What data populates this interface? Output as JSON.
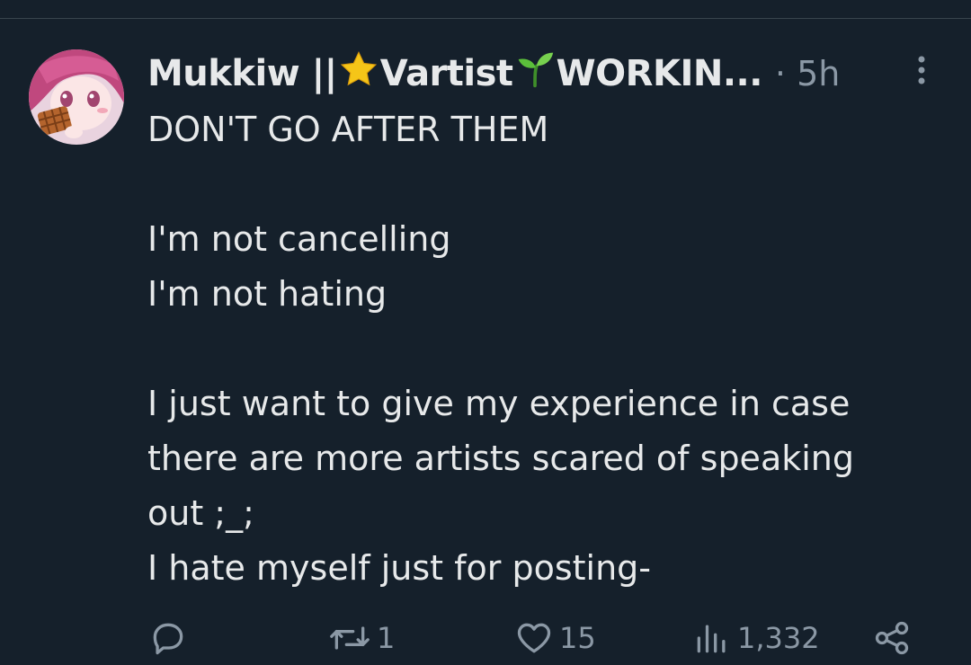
{
  "tweet": {
    "author": {
      "name_part1": "Mukkiw || ",
      "name_part2": "Vartist",
      "name_part3": " WORKIN...",
      "star_icon": "star-emoji-icon",
      "sprout_icon": "seedling-emoji-icon"
    },
    "meta": "· 5h",
    "lines": [
      "DON'T GO AFTER THEM",
      "",
      "I'm not cancelling",
      "I'm not hating",
      "",
      "I just want to give my experience in case",
      "there are more artists scared of speaking",
      "out ;_;",
      "I hate myself just for posting-"
    ],
    "actions": {
      "reply_icon": "reply-icon",
      "retweet_count": "1",
      "like_count": "15",
      "views_count": "1,332",
      "share_icon": "share-icon"
    }
  },
  "colors": {
    "background": "#15202b",
    "text": "#e7e9ea",
    "muted": "#8b98a5"
  }
}
